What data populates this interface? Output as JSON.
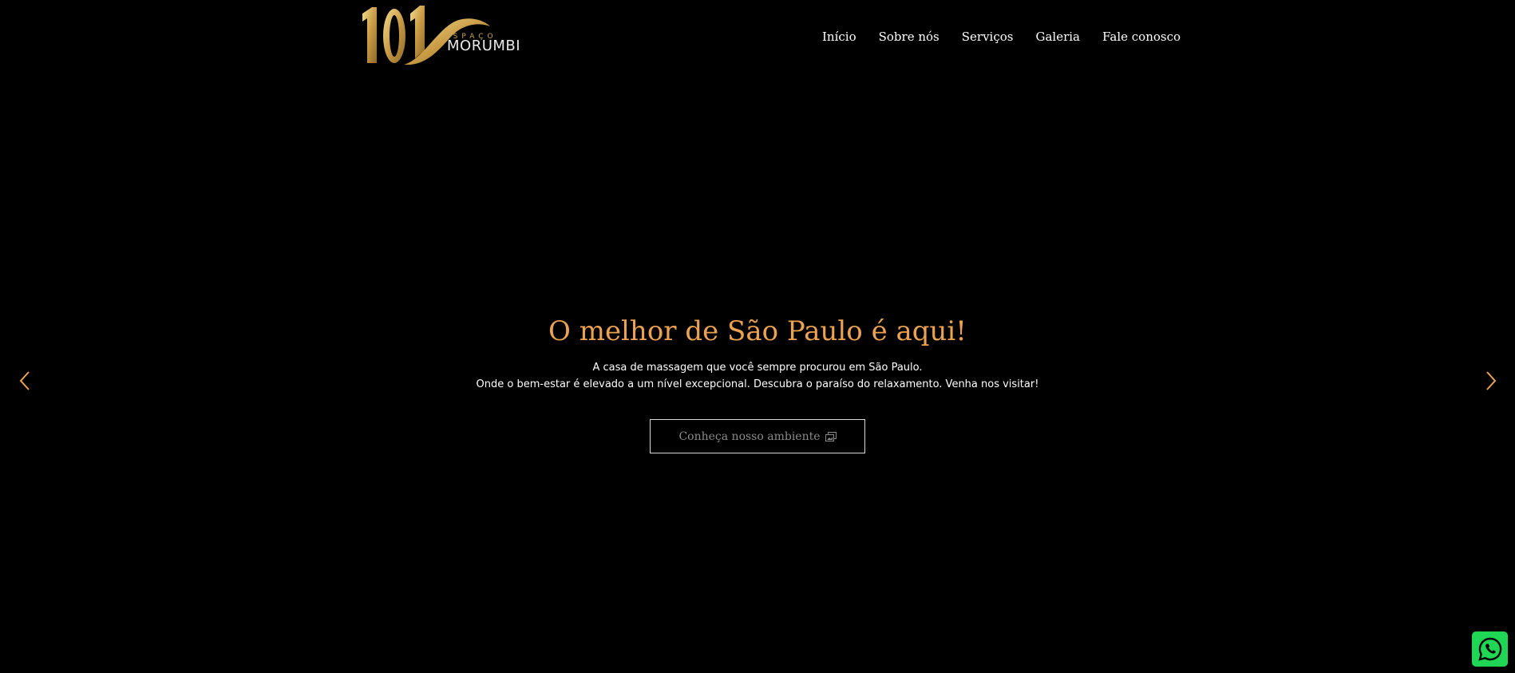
{
  "logo": {
    "number": "101",
    "small_text": "ESPAÇO",
    "word": "MORUMBI",
    "gold_color": "#c9a55a"
  },
  "nav": {
    "items": [
      {
        "label": "Início"
      },
      {
        "label": "Sobre nós"
      },
      {
        "label": "Serviços"
      },
      {
        "label": "Galeria"
      },
      {
        "label": "Fale conosco"
      }
    ]
  },
  "hero": {
    "title": "O melhor de São Paulo é aqui!",
    "line1": "A casa de massagem que você sempre procurou em São Paulo.",
    "line2": "Onde o bem-estar é elevado a um nível excepcional. Descubra o paraíso do relaxamento. Venha nos visitar!",
    "button_label": "Conheça nosso ambiente",
    "button_icon": "images-icon",
    "title_color": "#eba352"
  },
  "carousel": {
    "prev_icon": "chevron-left-icon",
    "next_icon": "chevron-right-icon",
    "arrow_color": "#eba352"
  },
  "whatsapp": {
    "icon": "whatsapp-icon",
    "color": "#1fd655"
  }
}
